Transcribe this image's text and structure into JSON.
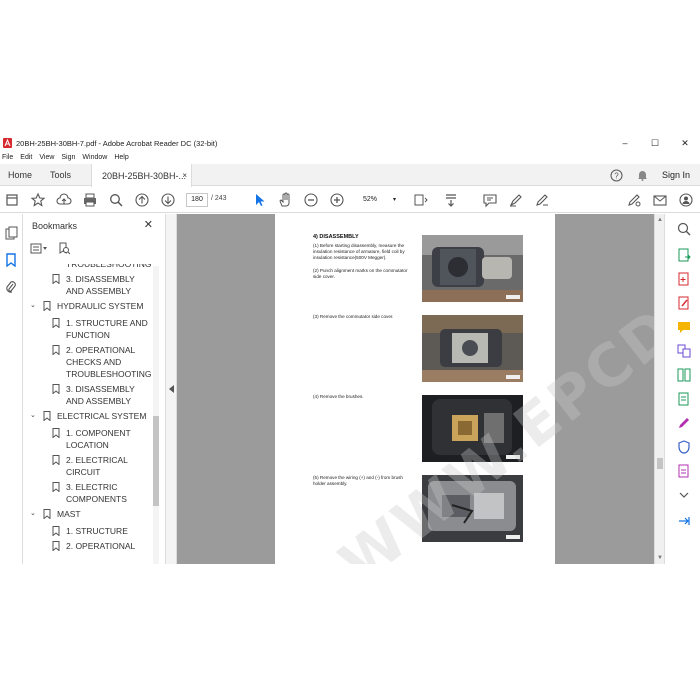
{
  "window": {
    "title": "20BH-25BH-30BH-7.pdf - Adobe Acrobat Reader DC (32-bit)",
    "minimize": "–",
    "maximize": "☐",
    "close": "✕"
  },
  "menu": [
    "File",
    "Edit",
    "View",
    "Sign",
    "Window",
    "Help"
  ],
  "tabs": {
    "home": "Home",
    "tools": "Tools",
    "document": "20BH-25BH-30BH-...",
    "close": "×"
  },
  "account": {
    "sign_in": "Sign In"
  },
  "toolbar": {
    "page_current": "180",
    "page_total": "/  243",
    "zoom": "52%",
    "zoom_caret": "▾"
  },
  "bookmarks": {
    "title": "Bookmarks",
    "close": "✕",
    "items": [
      {
        "text": "TROUBLESHOOTING",
        "level": 2
      },
      {
        "text": "3. DISASSEMBLY AND ASSEMBLY",
        "level": 2
      },
      {
        "text": "HYDRAULIC SYSTEM",
        "level": 1,
        "expanded": true
      },
      {
        "text": "1. STRUCTURE AND FUNCTION",
        "level": 2
      },
      {
        "text": "2. OPERATIONAL CHECKS AND TROUBLESHOOTING",
        "level": 2
      },
      {
        "text": "3. DISASSEMBLY AND ASSEMBLY",
        "level": 2
      },
      {
        "text": "ELECTRICAL SYSTEM",
        "level": 1,
        "expanded": true
      },
      {
        "text": "1. COMPONENT LOCATION",
        "level": 2
      },
      {
        "text": "2. ELECTRICAL CIRCUIT",
        "level": 2
      },
      {
        "text": "3. ELECTRIC COMPONENTS",
        "level": 2
      },
      {
        "text": "MAST",
        "level": 1,
        "expanded": true
      },
      {
        "text": "1. STRUCTURE",
        "level": 2
      },
      {
        "text": "2. OPERATIONAL",
        "level": 2
      }
    ]
  },
  "document": {
    "heading": "4) DISASSEMBLY",
    "steps": [
      "(1) Before starting disassembly, measure the insulation resistance of armature, field coil by insulation resistance(500V Megger).",
      "(2) Punch alignment marks on the commutator side cover.",
      "(3) Remove the commutator side cover.",
      "(4) Remove the brushes.",
      "(5) Remove the wiring (+) and (-) from brush holder assembly."
    ],
    "watermark": "WWW.EPCDESK.COM"
  },
  "colors": {
    "accent_blue": "#1473e6",
    "panel_gray": "#f2f2f2",
    "doc_background": "#9b9b9b"
  }
}
